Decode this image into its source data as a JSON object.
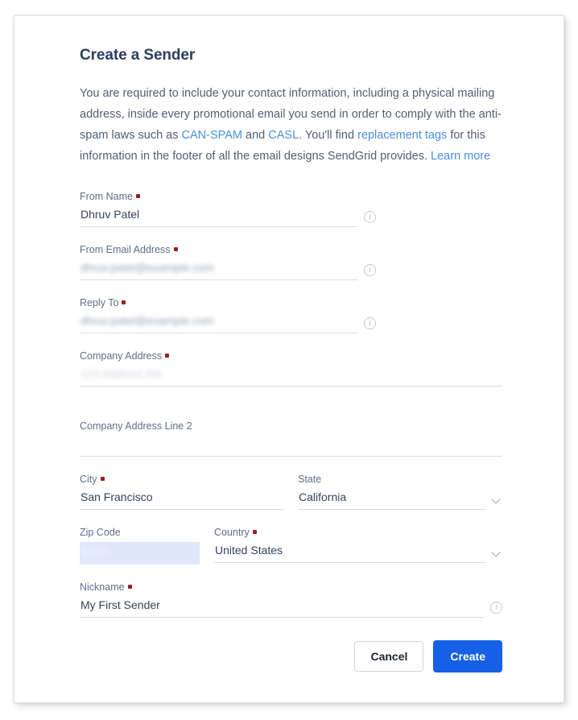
{
  "header": {
    "title": "Create a Sender"
  },
  "intro": {
    "part1": "You are required to include your contact information, including a physical mailing address, inside every promotional email you send in order to comply with the anti-spam laws such as ",
    "link_can_spam": "CAN-SPAM",
    "part2": " and ",
    "link_casl": "CASL",
    "part3": ". You'll find ",
    "link_replacement_tags": "replacement tags",
    "part4": " for this information in the footer of all the email designs SendGrid provides. ",
    "link_learn_more": "Learn more"
  },
  "form": {
    "from_name": {
      "label": "From Name",
      "required": true,
      "value": "Dhruv Patel",
      "redacted": false,
      "info_icon": "info-icon"
    },
    "from_email": {
      "label": "From Email Address",
      "required": true,
      "value": "dhruv.patel@example.com",
      "redacted": true,
      "info_icon": "info-icon"
    },
    "reply_to": {
      "label": "Reply To",
      "required": true,
      "value": "dhruv.patel@example.com",
      "redacted": true,
      "info_icon": "info-icon"
    },
    "company_address": {
      "label": "Company Address",
      "required": true,
      "value": "123 Address Rd",
      "redacted": true
    },
    "company_address_2": {
      "label": "Company Address Line 2",
      "required": false,
      "value": "",
      "redacted": false
    },
    "city": {
      "label": "City",
      "required": true,
      "value": "San Francisco",
      "redacted": false
    },
    "state": {
      "label": "State",
      "required": false,
      "value": "California",
      "redacted": false,
      "control": "dropdown",
      "icon": "chevron-down-icon"
    },
    "zip_code": {
      "label": "Zip Code",
      "required": false,
      "value": "94111",
      "redacted": true,
      "selected": true
    },
    "country": {
      "label": "Country",
      "required": true,
      "value": "United States",
      "redacted": false,
      "control": "dropdown",
      "icon": "chevron-down-icon"
    },
    "nickname": {
      "label": "Nickname",
      "required": true,
      "value": "My First Sender",
      "redacted": false,
      "info_icon": "info-icon"
    }
  },
  "footer": {
    "cancel_label": "Cancel",
    "create_label": "Create"
  },
  "colors": {
    "primary_button": "#1560e6",
    "link": "#4a90d9",
    "heading": "#2a3f5f",
    "label": "#5e6e88",
    "value": "#34425c",
    "required_dot": "#9c1f1f",
    "underline": "#d8dde5",
    "zip_selection": "#e0e7fa"
  }
}
